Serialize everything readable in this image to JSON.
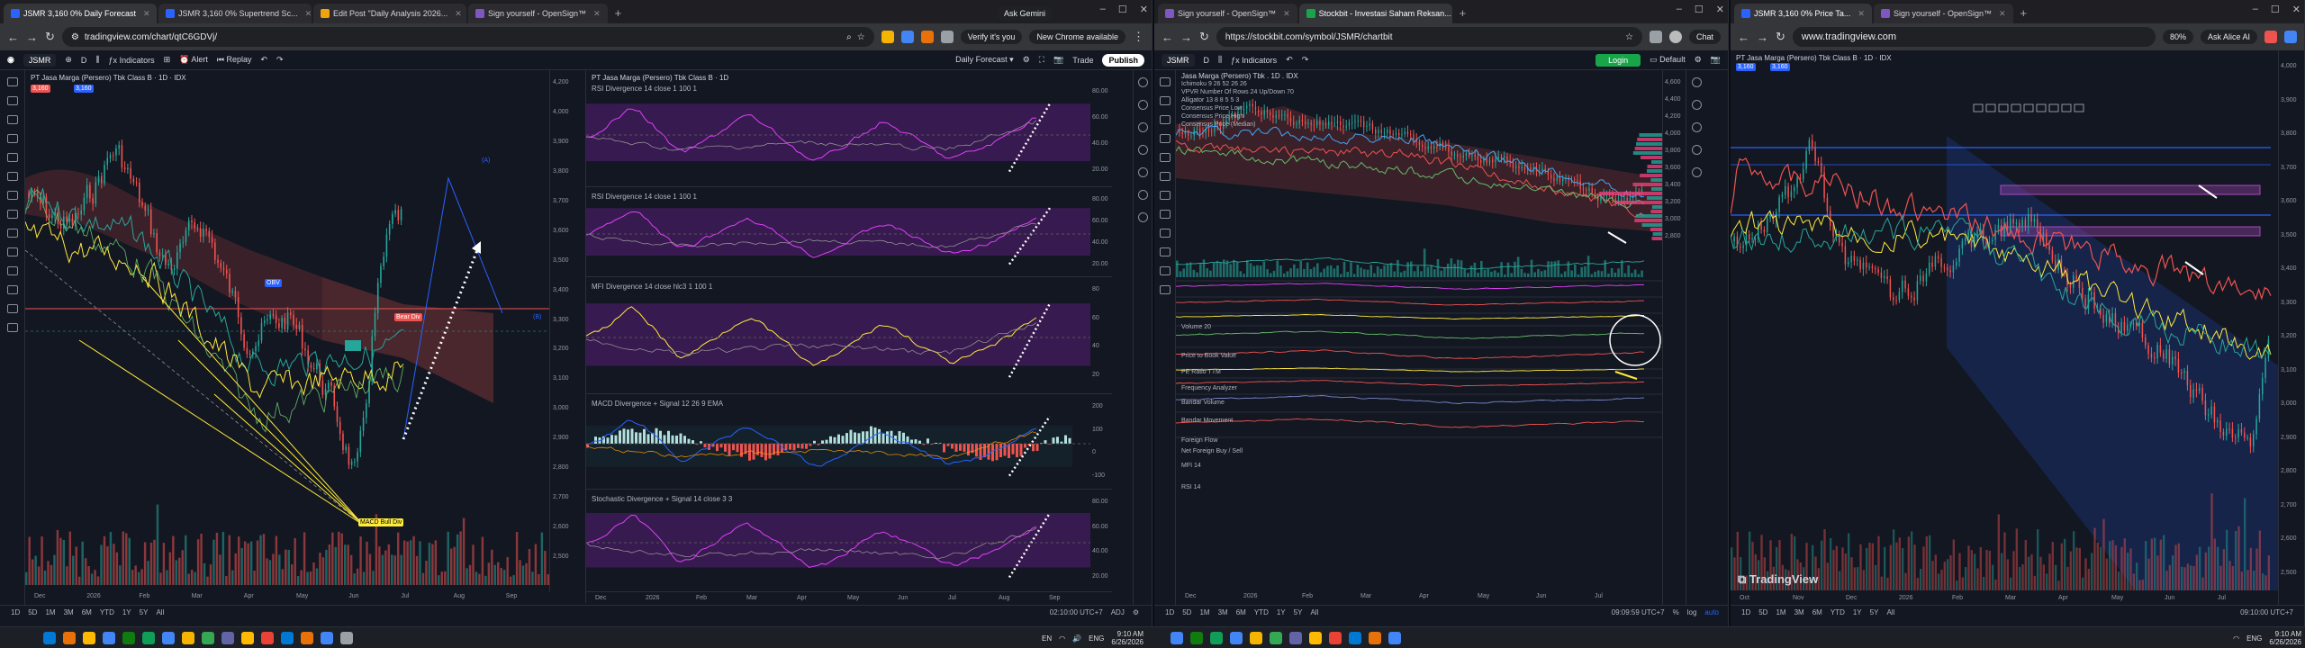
{
  "left_window": {
    "tabs": [
      "JSMR 3,160 0% Daily Forecast",
      "JSMR 3,160 0% Supertrend Sc...",
      "Edit Post \"Daily Analysis 2026...",
      "Sign yourself - OpenSign™"
    ],
    "url": "tradingview.com/chart/qtC6GDVj/",
    "verify_label": "Verify it's you",
    "update_label": "New Chrome available",
    "ask_gemini": "Ask Gemini",
    "toolbar": {
      "symbol": "JSMR",
      "timeframe": "D",
      "indicators": "Indicators",
      "alert": "Alert",
      "replay": "Replay",
      "layout_name": "Daily Forecast",
      "trade": "Trade",
      "publish": "Publish"
    },
    "chart_title": "PT Jasa Marga (Persero) Tbk Class B · 1D · IDX",
    "price_badge": "3,160",
    "price_scale": [
      "4,200",
      "4,000",
      "3,900",
      "3,800",
      "3,700",
      "3,600",
      "3,500",
      "3,400",
      "3,300",
      "3,200",
      "3,100",
      "3,000",
      "2,900",
      "2,800",
      "2,700",
      "2,600",
      "2,500"
    ],
    "x_labels": [
      "Dec",
      "2026",
      "Feb",
      "Mar",
      "Apr",
      "May",
      "Jun",
      "Jul",
      "Aug",
      "Sep"
    ],
    "annotation_labels": [
      "(A)",
      "(B)",
      "OBV",
      "Bear Div",
      "MACD Bull Div"
    ],
    "osc_title": "PT Jasa Marga (Persero) Tbk Class B · 1D",
    "osc_panes": [
      {
        "label": "RSI Divergence 14 close 1 100 1",
        "scale": [
          "80.00",
          "60.00",
          "40.00",
          "20.00"
        ]
      },
      {
        "label": "RSI Divergence 14 close 1 100 1",
        "scale": [
          "80.00",
          "60.00",
          "40.00",
          "20.00"
        ]
      },
      {
        "label": "MFI Divergence 14 close hlc3 1 100 1",
        "scale": [
          "80",
          "60",
          "40",
          "20"
        ]
      },
      {
        "label": "MACD Divergence + Signal 12 26 9 EMA",
        "scale": [
          "200",
          "100",
          "0",
          "-100"
        ]
      },
      {
        "label": "Stochastic Divergence + Signal 14 close 3 3",
        "scale": [
          "80.00",
          "60.00",
          "40.00",
          "20.00"
        ]
      }
    ],
    "osc_x_labels": [
      "Dec",
      "2026",
      "Feb",
      "Mar",
      "Apr",
      "May",
      "Jun",
      "Jul",
      "Aug",
      "Sep"
    ],
    "timeframes": [
      "1D",
      "5D",
      "1M",
      "3M",
      "6M",
      "YTD",
      "1Y",
      "5Y",
      "All"
    ],
    "clock": "02:10:00 UTC+7",
    "currency": "ADJ"
  },
  "middle_window": {
    "tabs": [
      "Sign yourself - OpenSign™",
      "Stockbit - Investasi Saham Reksan..."
    ],
    "url": "https://stockbit.com/symbol/JSMR/chartbit",
    "chat_label": "Chat",
    "toolbar": {
      "symbol": "JSMR",
      "timeframe": "D",
      "indicators": "Indicators",
      "login": "Login",
      "layout": "Default"
    },
    "chart_title": "Jasa Marga (Persero) Tbk . 1D . IDX",
    "legend_lines": [
      "Ichimoku 9 26 52 26 26",
      "VPVR Number Of Rows 24 Up/Down 70",
      "Alligator 13 8 8 5 5 3",
      "Consensus Price Low",
      "Consensus Price High",
      "Consensus Price (Median)"
    ],
    "sub_panes": [
      "Volume 20",
      "Price to Book Value",
      "PE Ratio TTM",
      "Frequency Analyzer",
      "Bandar Volume",
      "Bandar Movement",
      "Foreign Flow",
      "Net Foreign Buy / Sell",
      "MFI 14",
      "RSI 14"
    ],
    "price_scale": [
      "4,600",
      "4,400",
      "4,200",
      "4,000",
      "3,800",
      "3,600",
      "3,400",
      "3,200",
      "3,000",
      "2,800"
    ],
    "x_labels": [
      "Dec",
      "2026",
      "Feb",
      "Mar",
      "Apr",
      "May",
      "Jun",
      "Jul"
    ],
    "timeframes": [
      "1D",
      "5D",
      "1M",
      "3M",
      "6M",
      "YTD",
      "1Y",
      "5Y",
      "All"
    ],
    "clock": "09:09:59 UTC+7",
    "scale_modes": [
      "%",
      "log",
      "auto"
    ]
  },
  "right_window": {
    "tabs": [
      "JSMR 3,160 0% Price Ta...",
      "Sign yourself - OpenSign™"
    ],
    "url": "www.tradingview.com",
    "zoom": "80%",
    "ask_alice": "Ask Alice AI",
    "chart_title": "PT Jasa Marga (Persero) Tbk Class B · 1D · IDX",
    "price_badge": "3,160",
    "logo_text": "TradingView",
    "price_scale": [
      "4,000",
      "3,900",
      "3,800",
      "3,700",
      "3,600",
      "3,500",
      "3,400",
      "3,300",
      "3,200",
      "3,100",
      "3,000",
      "2,900",
      "2,800",
      "2,700",
      "2,600",
      "2,500"
    ],
    "x_labels": [
      "Oct",
      "Nov",
      "Dec",
      "2026",
      "Feb",
      "Mar",
      "Apr",
      "May",
      "Jun",
      "Jul"
    ],
    "timeframes": [
      "1D",
      "5D",
      "1M",
      "3M",
      "6M",
      "YTD",
      "1Y",
      "5Y",
      "All"
    ],
    "clock": "09:10:00 UTC+7"
  },
  "taskbar": {
    "left_tray": {
      "lang": "ENG",
      "time": "9:10 AM",
      "date": "6/26/2026",
      "ime": "EN"
    },
    "right_tray": {
      "lang": "ENG",
      "time": "9:10 AM",
      "date": "6/26/2026"
    }
  },
  "colors": {
    "bg": "#131722",
    "up": "#26a69a",
    "down": "#ef5350",
    "purple": "#7b1fa2",
    "stockbit_green": "#18a54a"
  }
}
